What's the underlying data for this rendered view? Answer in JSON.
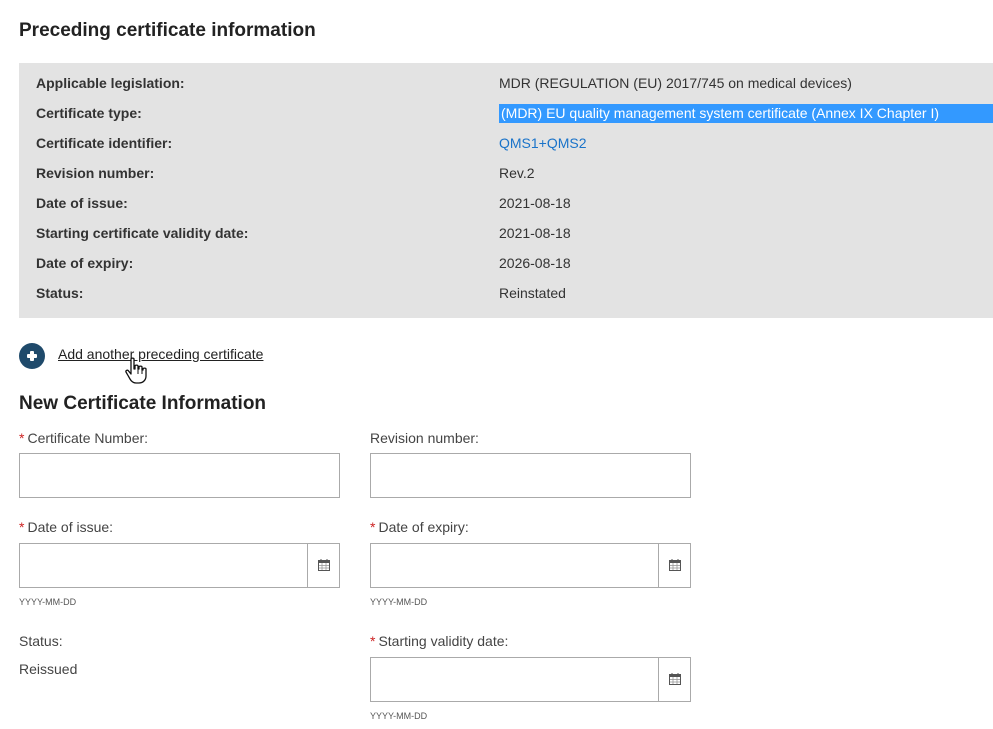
{
  "preceding": {
    "title": "Preceding certificate information",
    "rows": [
      {
        "label": "Applicable legislation:",
        "value": "MDR (REGULATION (EU) 2017/745 on medical devices)"
      },
      {
        "label": "Certificate type:",
        "value": "(MDR) EU quality management system certificate (Annex IX Chapter I)"
      },
      {
        "label": "Certificate identifier:",
        "value": "QMS1+QMS2"
      },
      {
        "label": "Revision number:",
        "value": "Rev.2"
      },
      {
        "label": "Date of issue:",
        "value": "2021-08-18"
      },
      {
        "label": "Starting certificate validity date:",
        "value": "2021-08-18"
      },
      {
        "label": "Date of expiry:",
        "value": "2026-08-18"
      },
      {
        "label": "Status:",
        "value": "Reinstated"
      }
    ],
    "add_link": "Add another preceding certificate"
  },
  "new_cert": {
    "title": "New Certificate Information",
    "certificate_number_label": "Certificate Number:",
    "revision_number_label": "Revision number:",
    "date_of_issue_label": "Date of issue:",
    "date_of_expiry_label": "Date of expiry:",
    "status_label": "Status:",
    "status_value": "Reissued",
    "starting_validity_label": "Starting validity date:",
    "date_hint": "YYYY-MM-DD",
    "required_mark": "*"
  },
  "colors": {
    "panel_bg": "#e3e3e3",
    "link": "#1a73c9",
    "selection": "#3399ff",
    "add_icon": "#1f4a6b",
    "required": "#cc2222"
  },
  "icons": {
    "add": "plus-circle-icon",
    "calendar": "calendar-icon",
    "cursor": "hand-pointer-cursor-icon"
  }
}
